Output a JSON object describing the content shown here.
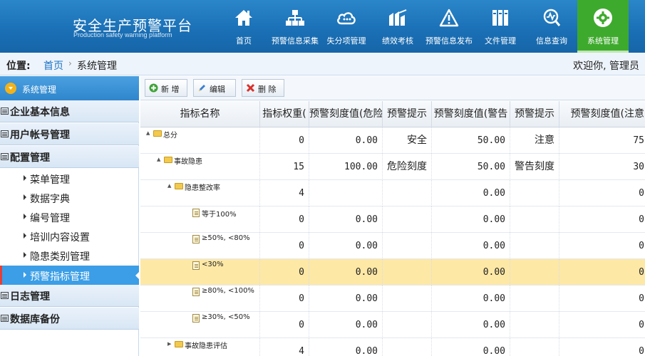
{
  "header": {
    "title": "安全生产预警平台",
    "subtitle": "Production safety warning platform",
    "nav": [
      {
        "label": "首页",
        "icon": "home-icon"
      },
      {
        "label": "预警信息采集",
        "icon": "sitemap-icon"
      },
      {
        "label": "失分项管理",
        "icon": "cloud-icon"
      },
      {
        "label": "绩效考核",
        "icon": "building-icon"
      },
      {
        "label": "预警信息发布",
        "icon": "warning-icon"
      },
      {
        "label": "文件管理",
        "icon": "files-icon"
      },
      {
        "label": "信息查询",
        "icon": "search-monitor-icon"
      },
      {
        "label": "系统管理",
        "icon": "gear-icon",
        "active": true
      }
    ]
  },
  "location": {
    "label": "位置:",
    "home": "首页",
    "separator": "›",
    "current": "系统管理",
    "welcome": "欢迎你, 管理员"
  },
  "sidebar": {
    "title": "系统管理",
    "groups": [
      "企业基本信息",
      "用户帐号管理",
      "配置管理",
      "日志管理",
      "数据库备份"
    ],
    "items": [
      "菜单管理",
      "数据字典",
      "编号管理",
      "培训内容设置",
      "隐患类别管理",
      "预警指标管理"
    ],
    "active_item": "预警指标管理"
  },
  "toolbar": {
    "add": "新 增",
    "edit": "编辑",
    "delete": "删 除"
  },
  "grid": {
    "columns": [
      "指标名称",
      "指标权重(",
      "预警刻度值(危险",
      "预警提示",
      "预警刻度值(警告",
      "预警提示",
      "预警刻度值(注意"
    ],
    "rows": [
      {
        "name": "总分",
        "weight": "0",
        "danger": "0.00",
        "tip1": "安全",
        "warn": "50.00",
        "tip2": "注意",
        "notice": "75"
      },
      {
        "name": "事故隐患",
        "weight": "15",
        "danger": "100.00",
        "tip1": "危险刻度",
        "warn": "50.00",
        "tip2": "警告刻度",
        "notice": "30"
      },
      {
        "name": "隐患整改率",
        "weight": "4",
        "danger": "",
        "tip1": "",
        "warn": "0.00",
        "tip2": "",
        "notice": "0"
      },
      {
        "name": "等于100%",
        "weight": "0",
        "danger": "0.00",
        "tip1": "",
        "warn": "0.00",
        "tip2": "",
        "notice": "0"
      },
      {
        "name": "≥50%, <80%",
        "weight": "0",
        "danger": "0.00",
        "tip1": "",
        "warn": "0.00",
        "tip2": "",
        "notice": "0"
      },
      {
        "name": "<30%",
        "weight": "0",
        "danger": "0.00",
        "tip1": "",
        "warn": "0.00",
        "tip2": "",
        "notice": "0"
      },
      {
        "name": "≥80%, <100%",
        "weight": "0",
        "danger": "0.00",
        "tip1": "",
        "warn": "0.00",
        "tip2": "",
        "notice": "0"
      },
      {
        "name": "≥30%, <50%",
        "weight": "0",
        "danger": "0.00",
        "tip1": "",
        "warn": "0.00",
        "tip2": "",
        "notice": "0"
      },
      {
        "name": "事故隐患评估",
        "weight": "4",
        "danger": "0.00",
        "tip1": "",
        "warn": "0.00",
        "tip2": "",
        "notice": "0"
      }
    ]
  },
  "colors": {
    "header": "#1a6fb5",
    "active_nav": "#3eaa2d",
    "active_sidebar": "#3b9ee6",
    "selected_row": "#fde8a6"
  }
}
